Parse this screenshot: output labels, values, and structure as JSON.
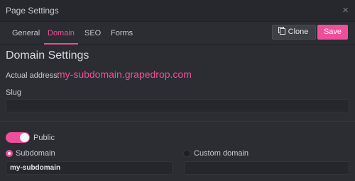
{
  "window": {
    "title": "Page Settings"
  },
  "tabs": [
    "General",
    "Domain",
    "SEO",
    "Forms"
  ],
  "active_tab": "Domain",
  "buttons": {
    "clone": "Clone",
    "save": "Save"
  },
  "domain": {
    "heading": "Domain Settings",
    "actual_address_label": "Actual address:",
    "actual_address": "my-subdomain.grapedrop.com",
    "slug_label": "Slug",
    "slug_value": "",
    "public_label": "Public",
    "public_enabled": true,
    "subdomain_label": "Subdomain",
    "subdomain_value": "my-subdomain",
    "custom_domain_label": "Custom domain",
    "custom_domain_value": "",
    "selected_option": "Subdomain"
  },
  "colors": {
    "accent": "#ef4f9a",
    "background": "#2b2d33",
    "titlebar": "#26282d"
  },
  "icons": {
    "close": "close-icon",
    "clone": "clone-icon"
  }
}
